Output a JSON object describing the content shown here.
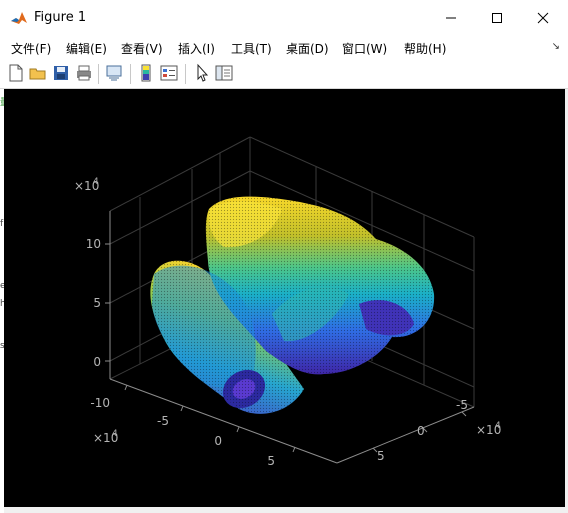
{
  "window": {
    "title": "Figure 1"
  },
  "menu": [
    "文件(F)",
    "编辑(E)",
    "查看(V)",
    "插入(I)",
    "工具(T)",
    "桌面(D)",
    "窗口(W)",
    "帮助(H)"
  ],
  "toolbar": {
    "buttons": [
      "new-figure-icon",
      "open-file-icon",
      "save-icon",
      "print-icon",
      "link-figure-icon",
      "insert-colorbar-icon",
      "insert-legend-icon",
      "edit-plot-icon",
      "property-inspector-icon"
    ]
  },
  "colors": {
    "plot_bg": "#000000",
    "axis": "#8c8c8c",
    "grid": "#3a3a3a",
    "parula_low": "#3e26a8",
    "parula_high": "#f9fb0e"
  },
  "axes": {
    "z_multiplier": "×10",
    "z_exp": "4",
    "z_ticks": [
      "10",
      "5",
      "0"
    ],
    "x_multiplier": "×10",
    "x_exp": "4",
    "x_ticks": [
      "-10",
      "-5",
      "0",
      "5"
    ],
    "y_multiplier": "×10",
    "y_exp": "4",
    "y_ticks": [
      "-5",
      "0",
      "5"
    ]
  },
  "side_glyphs": [
    "量",
    "f",
    "e",
    "h",
    "s"
  ]
}
